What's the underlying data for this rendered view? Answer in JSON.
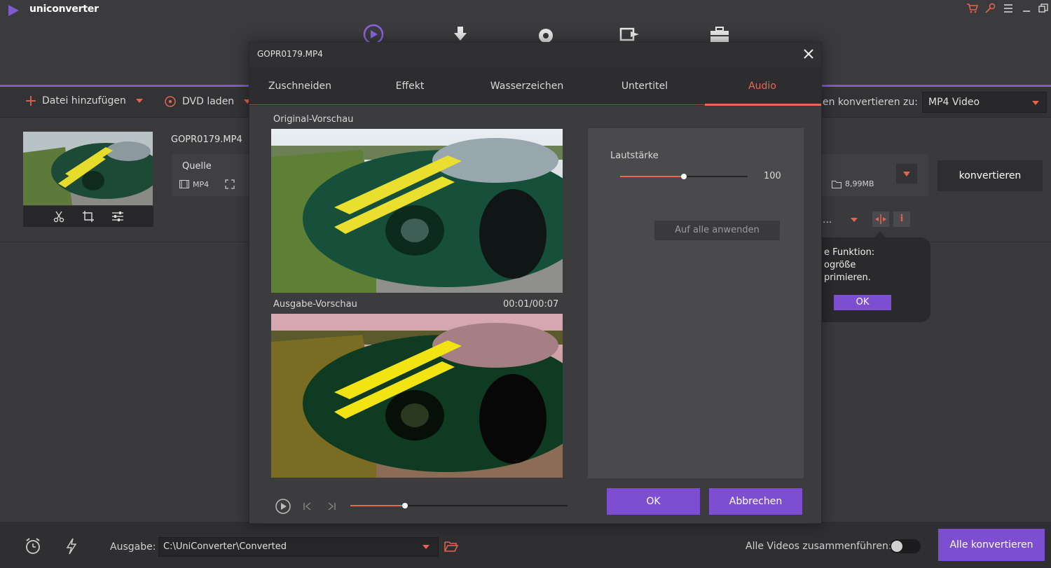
{
  "app": {
    "name": "uniconverter",
    "accent_color": "#7d5ccf",
    "highlight_color": "#e9684f"
  },
  "toolbar": {
    "add_file_label": "Datei hinzufügen",
    "load_dvd_label": "DVD laden",
    "convert_to_label": "en konvertieren zu:",
    "format_value": "MP4 Video"
  },
  "file": {
    "name": "GOPR0179.MP4",
    "source_label": "Quelle",
    "source_format": "MP4",
    "target_size": "8,99MB",
    "convert_label": "konvertieren",
    "row_dropdown_text": "..."
  },
  "tooltip": {
    "line1": "e Funktion:",
    "line2": "ogröße",
    "line3": "primieren.",
    "ok_label": "OK"
  },
  "bottom": {
    "output_label": "Ausgabe:",
    "output_path": "C:\\UniConverter\\Converted",
    "merge_label": "Alle Videos zusammenführen:",
    "merge_enabled": false,
    "convert_all_label": "Alle konvertieren"
  },
  "dialog": {
    "title": "GOPR0179.MP4",
    "tabs": [
      {
        "label": "Zuschneiden",
        "active": false
      },
      {
        "label": "Effekt",
        "active": false
      },
      {
        "label": "Wasserzeichen",
        "active": false
      },
      {
        "label": "Untertitel",
        "active": false
      },
      {
        "label": "Audio",
        "active": true
      }
    ],
    "original_preview_label": "Original-Vorschau",
    "output_preview_label": "Ausgabe-Vorschau",
    "timecode": "00:01/00:07",
    "playback_progress": 0.25,
    "audio": {
      "volume_label": "Lautstärke",
      "volume_value": "100",
      "volume_fraction": 0.5,
      "apply_all_label": "Auf alle anwenden"
    },
    "ok_label": "OK",
    "cancel_label": "Abbrechen"
  }
}
